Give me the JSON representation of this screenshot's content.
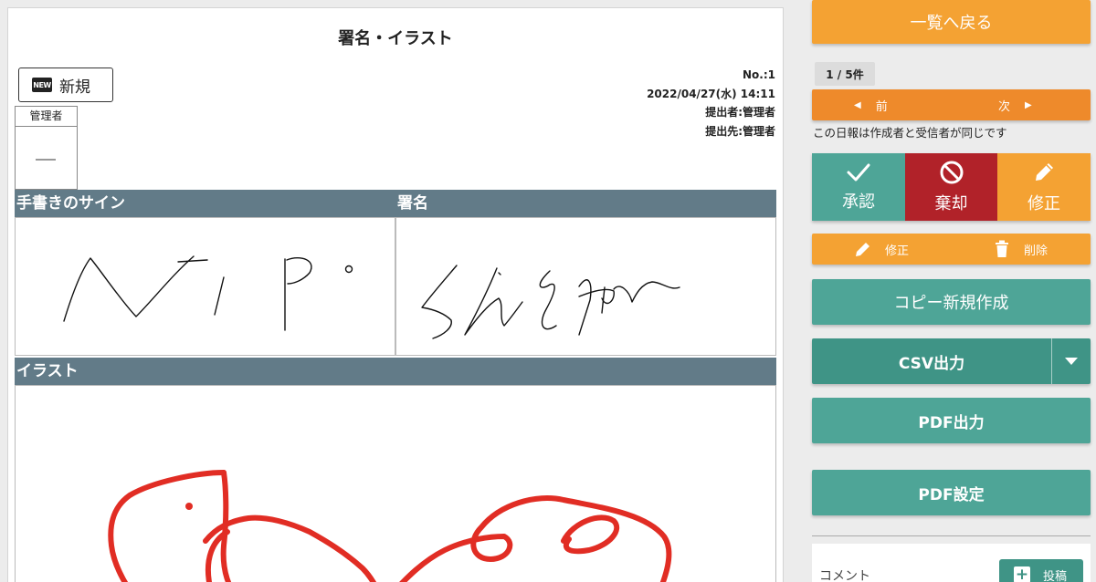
{
  "document": {
    "title": "署名・イラスト",
    "badge_icon": "NEW",
    "badge_label": "新規",
    "number": "No.:1",
    "datetime": "2022/04/27(水) 14:11",
    "submitter": "提出者:管理者",
    "recipient": "提出先:管理者",
    "stamp_label": "管理者",
    "sections": {
      "handwritten_sign": "手書きのサイン",
      "signature": "署名",
      "illustration": "イラスト"
    }
  },
  "sidebar": {
    "back_label": "一覧へ戻る",
    "count": "1 / 5件",
    "prev_label": "前",
    "next_label": "次",
    "note": "この日報は作成者と受信者が同じです",
    "approve_label": "承認",
    "reject_label": "棄却",
    "edit_label": "修正",
    "small_edit_label": "修正",
    "delete_label": "削除",
    "copy_new_label": "コピー新規作成",
    "csv_label": "CSV出力",
    "pdf_label": "PDF出力",
    "pdf_settings_label": "PDF設定",
    "comment_label": "コメント",
    "post_label": "投稿"
  },
  "colors": {
    "orange": "#f4a233",
    "orange_dark": "#ee8a2b",
    "teal": "#4ea597",
    "teal_dark": "#3f9486",
    "red": "#b12229",
    "section_header": "#627b88",
    "ink_red": "#e12d24"
  }
}
